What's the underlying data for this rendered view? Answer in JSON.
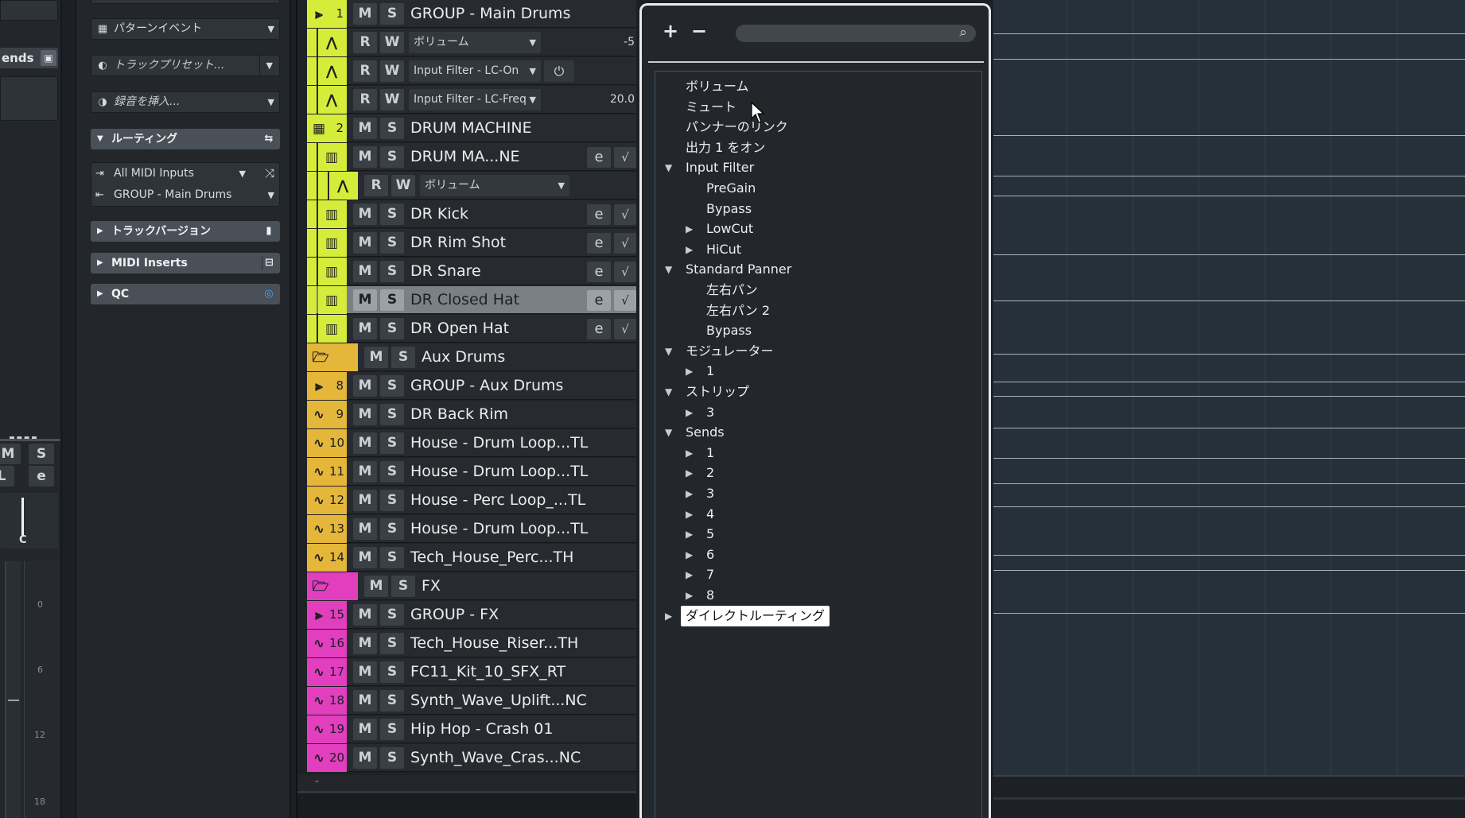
{
  "left_strip": {
    "sends_label": "ends",
    "mute": "M",
    "solo": "S",
    "listen": "L",
    "edit": "e",
    "pan": "C",
    "scale": [
      "0",
      "6",
      "12",
      "18"
    ]
  },
  "inspector": {
    "pattern_event": "パターンイベント",
    "track_preset": "トラックプリセット...",
    "insert_recording": "録音を挿入...",
    "routing": "ルーティング",
    "midi_input": "All MIDI Inputs",
    "output": "GROUP - Main Drums",
    "track_version": "トラックバージョン",
    "midi_inserts": "MIDI Inserts",
    "qc": "QC"
  },
  "tracks": [
    {
      "num": "1",
      "name": "GROUP - Main Drums",
      "color": "#d6ec3a",
      "icon": "group-icon",
      "type": "track"
    },
    {
      "type": "auto",
      "param": "ボリューム",
      "value": "-5",
      "color": "#d6ec3a"
    },
    {
      "type": "auto",
      "param": "Input Filter - LC-On",
      "value": "⏻",
      "color": "#d6ec3a",
      "power": true
    },
    {
      "type": "auto",
      "param": "Input Filter - LC-Freq",
      "value": "20.0",
      "color": "#d6ec3a"
    },
    {
      "num": "2",
      "name": "DRUM MACHINE",
      "color": "#d6ec3a",
      "icon": "instrument-icon",
      "type": "track"
    },
    {
      "type": "midi",
      "name": "DRUM MA...NE",
      "color": "#d6ec3a"
    },
    {
      "type": "auto2",
      "param": "ボリューム",
      "color": "#d6ec3a"
    },
    {
      "type": "midi",
      "name": "DR Kick",
      "color": "#d6ec3a"
    },
    {
      "type": "midi",
      "name": "DR Rim Shot",
      "color": "#d6ec3a"
    },
    {
      "type": "midi",
      "name": "DR Snare",
      "color": "#d6ec3a"
    },
    {
      "type": "midi",
      "name": "DR Closed Hat",
      "color": "#d6ec3a",
      "selected": true
    },
    {
      "type": "midi",
      "name": "DR Open Hat",
      "color": "#d6ec3a"
    },
    {
      "type": "folder",
      "name": "Aux Drums",
      "color": "#e4b63a"
    },
    {
      "num": "8",
      "name": "GROUP - Aux Drums",
      "color": "#e4b63a",
      "icon": "group-icon",
      "type": "track"
    },
    {
      "num": "9",
      "name": "DR Back Rim",
      "color": "#e4b63a",
      "icon": "audio-icon",
      "type": "track"
    },
    {
      "num": "10",
      "name": "House - Drum Loop...TL",
      "color": "#e4b63a",
      "icon": "audio-icon",
      "type": "track"
    },
    {
      "num": "11",
      "name": "House - Drum Loop...TL",
      "color": "#e4b63a",
      "icon": "audio-icon",
      "type": "track"
    },
    {
      "num": "12",
      "name": "House - Perc Loop_...TL",
      "color": "#e4b63a",
      "icon": "audio-icon",
      "type": "track"
    },
    {
      "num": "13",
      "name": "House - Drum Loop...TL",
      "color": "#e4b63a",
      "icon": "audio-icon",
      "type": "track"
    },
    {
      "num": "14",
      "name": "Tech_House_Perc...TH",
      "color": "#e4b63a",
      "icon": "audio-icon",
      "type": "track"
    },
    {
      "type": "folder",
      "name": "FX",
      "color": "#e23fbf"
    },
    {
      "num": "15",
      "name": "GROUP - FX",
      "color": "#e23fbf",
      "icon": "group-icon",
      "type": "track"
    },
    {
      "num": "16",
      "name": "Tech_House_Riser...TH",
      "color": "#e23fbf",
      "icon": "audio-icon",
      "type": "track"
    },
    {
      "num": "17",
      "name": "FC11_Kit_10_SFX_RT",
      "color": "#e23fbf",
      "icon": "audio-icon",
      "type": "track"
    },
    {
      "num": "18",
      "name": "Synth_Wave_Uplift...NC",
      "color": "#e23fbf",
      "icon": "audio-icon",
      "type": "track"
    },
    {
      "num": "19",
      "name": "Hip Hop - Crash 01",
      "color": "#e23fbf",
      "icon": "audio-icon",
      "type": "track"
    },
    {
      "num": "20",
      "name": "Synth_Wave_Cras...NC",
      "color": "#e23fbf",
      "icon": "audio-icon",
      "type": "track"
    }
  ],
  "buttons": {
    "mute": "M",
    "solo": "S",
    "read": "R",
    "write": "W",
    "edit": "e",
    "monitor": "√"
  },
  "tracks_footer": "-",
  "popup": {
    "plus": "+",
    "minus": "−",
    "search_placeholder": "",
    "tree": [
      {
        "label": "ボリューム",
        "level": 0,
        "twisty": ""
      },
      {
        "label": "ミュート",
        "level": 0,
        "twisty": ""
      },
      {
        "label": "パンナーのリンク",
        "level": 0,
        "twisty": ""
      },
      {
        "label": "出力 1 をオン",
        "level": 0,
        "twisty": ""
      },
      {
        "label": "Input Filter",
        "level": 0,
        "twisty": "▼"
      },
      {
        "label": "PreGain",
        "level": 1,
        "twisty": ""
      },
      {
        "label": "Bypass",
        "level": 1,
        "twisty": ""
      },
      {
        "label": "LowCut",
        "level": 1,
        "twisty": "▶"
      },
      {
        "label": "HiCut",
        "level": 1,
        "twisty": "▶"
      },
      {
        "label": "Standard Panner",
        "level": 0,
        "twisty": "▼"
      },
      {
        "label": "左右パン",
        "level": 1,
        "twisty": ""
      },
      {
        "label": "左右パン 2",
        "level": 1,
        "twisty": ""
      },
      {
        "label": "Bypass",
        "level": 1,
        "twisty": ""
      },
      {
        "label": "モジュレーター",
        "level": 0,
        "twisty": "▼"
      },
      {
        "label": "1",
        "level": 1,
        "twisty": "▶"
      },
      {
        "label": "ストリップ",
        "level": 0,
        "twisty": "▼"
      },
      {
        "label": "3",
        "level": 1,
        "twisty": "▶"
      },
      {
        "label": "Sends",
        "level": 0,
        "twisty": "▼"
      },
      {
        "label": "1",
        "level": 1,
        "twisty": "▶"
      },
      {
        "label": "2",
        "level": 1,
        "twisty": "▶"
      },
      {
        "label": "3",
        "level": 1,
        "twisty": "▶"
      },
      {
        "label": "4",
        "level": 1,
        "twisty": "▶"
      },
      {
        "label": "5",
        "level": 1,
        "twisty": "▶"
      },
      {
        "label": "6",
        "level": 1,
        "twisty": "▶"
      },
      {
        "label": "7",
        "level": 1,
        "twisty": "▶"
      },
      {
        "label": "8",
        "level": 1,
        "twisty": "▶"
      },
      {
        "label": "ダイレクトルーティング",
        "level": 0,
        "twisty": "▶",
        "highlight": true
      }
    ]
  },
  "colors": {
    "yellow": "#d6ec3a",
    "orange": "#e4b63a",
    "magenta": "#e23fbf",
    "selected_track": "#7a8086"
  }
}
